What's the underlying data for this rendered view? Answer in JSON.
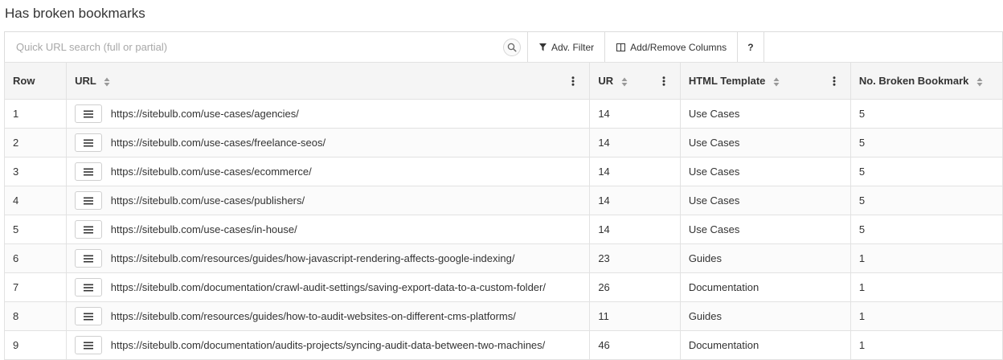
{
  "page": {
    "title": "Has broken bookmarks"
  },
  "toolbar": {
    "search_placeholder": "Quick URL search (full or partial)",
    "adv_filter_label": "Adv. Filter",
    "columns_label": "Add/Remove Columns",
    "help_label": "?"
  },
  "table": {
    "columns": {
      "row": "Row",
      "url": "URL",
      "ur": "UR",
      "template": "HTML Template",
      "broken": "No. Broken Bookmark"
    },
    "rows": [
      {
        "row": "1",
        "url": "https://sitebulb.com/use-cases/agencies/",
        "ur": "14",
        "template": "Use Cases",
        "broken": "5"
      },
      {
        "row": "2",
        "url": "https://sitebulb.com/use-cases/freelance-seos/",
        "ur": "14",
        "template": "Use Cases",
        "broken": "5"
      },
      {
        "row": "3",
        "url": "https://sitebulb.com/use-cases/ecommerce/",
        "ur": "14",
        "template": "Use Cases",
        "broken": "5"
      },
      {
        "row": "4",
        "url": "https://sitebulb.com/use-cases/publishers/",
        "ur": "14",
        "template": "Use Cases",
        "broken": "5"
      },
      {
        "row": "5",
        "url": "https://sitebulb.com/use-cases/in-house/",
        "ur": "14",
        "template": "Use Cases",
        "broken": "5"
      },
      {
        "row": "6",
        "url": "https://sitebulb.com/resources/guides/how-javascript-rendering-affects-google-indexing/",
        "ur": "23",
        "template": "Guides",
        "broken": "1"
      },
      {
        "row": "7",
        "url": "https://sitebulb.com/documentation/crawl-audit-settings/saving-export-data-to-a-custom-folder/",
        "ur": "26",
        "template": "Documentation",
        "broken": "1"
      },
      {
        "row": "8",
        "url": "https://sitebulb.com/resources/guides/how-to-audit-websites-on-different-cms-platforms/",
        "ur": "11",
        "template": "Guides",
        "broken": "1"
      },
      {
        "row": "9",
        "url": "https://sitebulb.com/documentation/audits-projects/syncing-audit-data-between-two-machines/",
        "ur": "46",
        "template": "Documentation",
        "broken": "1"
      }
    ]
  }
}
